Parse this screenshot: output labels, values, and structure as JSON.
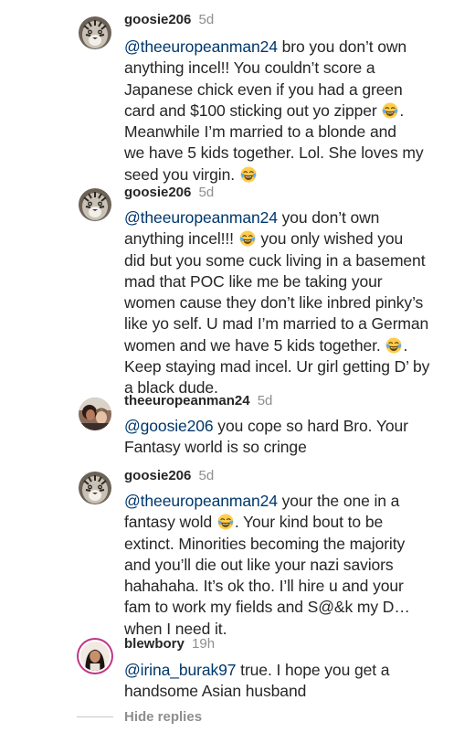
{
  "comments": [
    {
      "username": "goosie206",
      "time": "5d",
      "avatar": "tiger-avatar",
      "mention": "@theeuropeanman24",
      "lines": [
        " bro you don’t own",
        "anything incel!! You couldn’t score a",
        "Japanese chick even if you had a green",
        "card and $100 sticking out yo zipper ",
        ". Meanwhile I’m married to a blonde and",
        "we have 5 kids together. Lol. She loves my",
        "seed you virgin. "
      ]
    },
    {
      "username": "goosie206",
      "time": "5d",
      "avatar": "tiger-avatar",
      "mention": "@theeuropeanman24",
      "lines": [
        " you don’t own",
        "anything incel!!! ",
        " you only wished you",
        "did but you some cuck living in a basement",
        "mad that POC like me be taking your",
        "women cause they don’t like inbred pinky’s",
        "like yo self. U mad I’m married to a German",
        "women and we have 5 kids together. ",
        ".",
        "Keep staying mad incel. Ur girl getting D’ by",
        "a black dude."
      ]
    },
    {
      "username": "theeuropeanman24",
      "time": "5d",
      "avatar": "couple-avatar",
      "mention": "@goosie206",
      "lines": [
        " you cope so hard Bro. Your",
        "Fantasy world is so cringe"
      ]
    },
    {
      "username": "goosie206",
      "time": "5d",
      "avatar": "tiger-avatar",
      "mention": "@theeuropeanman24",
      "lines": [
        " your the one in a",
        "fantasy wold ",
        ". Your kind bout to be",
        "extinct. Minorities becoming the majority",
        "and you’ll die out like your nazi saviors",
        "hahahaha. It’s ok tho. I’ll hire u and your",
        "fam to work my fields and S@&k my D…",
        "when I need it."
      ]
    },
    {
      "username": "blewbory",
      "time": "19h",
      "avatar": "woman-avatar-story-ring",
      "mention": "@irina_burak97",
      "lines": [
        " true. I hope you get a",
        "handsome Asian husband"
      ]
    }
  ],
  "hide_replies": "Hide replies",
  "emoji_name": "face-with-tears-of-joy-emoji",
  "colors": {
    "text": "#262626",
    "secondary": "#8e8e8e",
    "mention": "#00376b",
    "story_ring": "#c13584"
  }
}
